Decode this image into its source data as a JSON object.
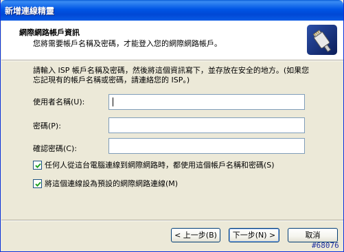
{
  "window": {
    "title": "新增連線精靈"
  },
  "header": {
    "title": "網際網路帳戶資訊",
    "subtitle": "您將需要帳戶名稱及密碼，才能登入您的網際網路帳戶。",
    "icon": "network-cable-plug-icon"
  },
  "intro": {
    "line1": "請輸入 ISP 帳戶名稱及密碼，然後將這個資訊寫下，並存放在安全的地方。(如果您",
    "line2": "忘記現有的帳戶名稱或密碼，請連絡您的 ISP。)"
  },
  "fields": {
    "username_label": "使用者名稱(U):",
    "username_value": "",
    "password_label": "密碼(P):",
    "password_value": "",
    "confirm_label": "確認密碼(C):",
    "confirm_value": ""
  },
  "options": {
    "use_for_all_label": "任何人從這台電腦連線到網際網路時，都使用這個帳戶名稱和密碼(S)",
    "use_for_all_checked": true,
    "default_connection_label": "將這個連線設為預設的網際網路連線(M)",
    "default_connection_checked": true
  },
  "buttons": {
    "back": "< 上一步(B)",
    "next": "下一步(N) >",
    "cancel": "取消"
  },
  "watermark": "#68076",
  "colors": {
    "titlebar": "#0055E5",
    "dialog_bg": "#ECE9D8",
    "input_border": "#7F9DB9"
  }
}
